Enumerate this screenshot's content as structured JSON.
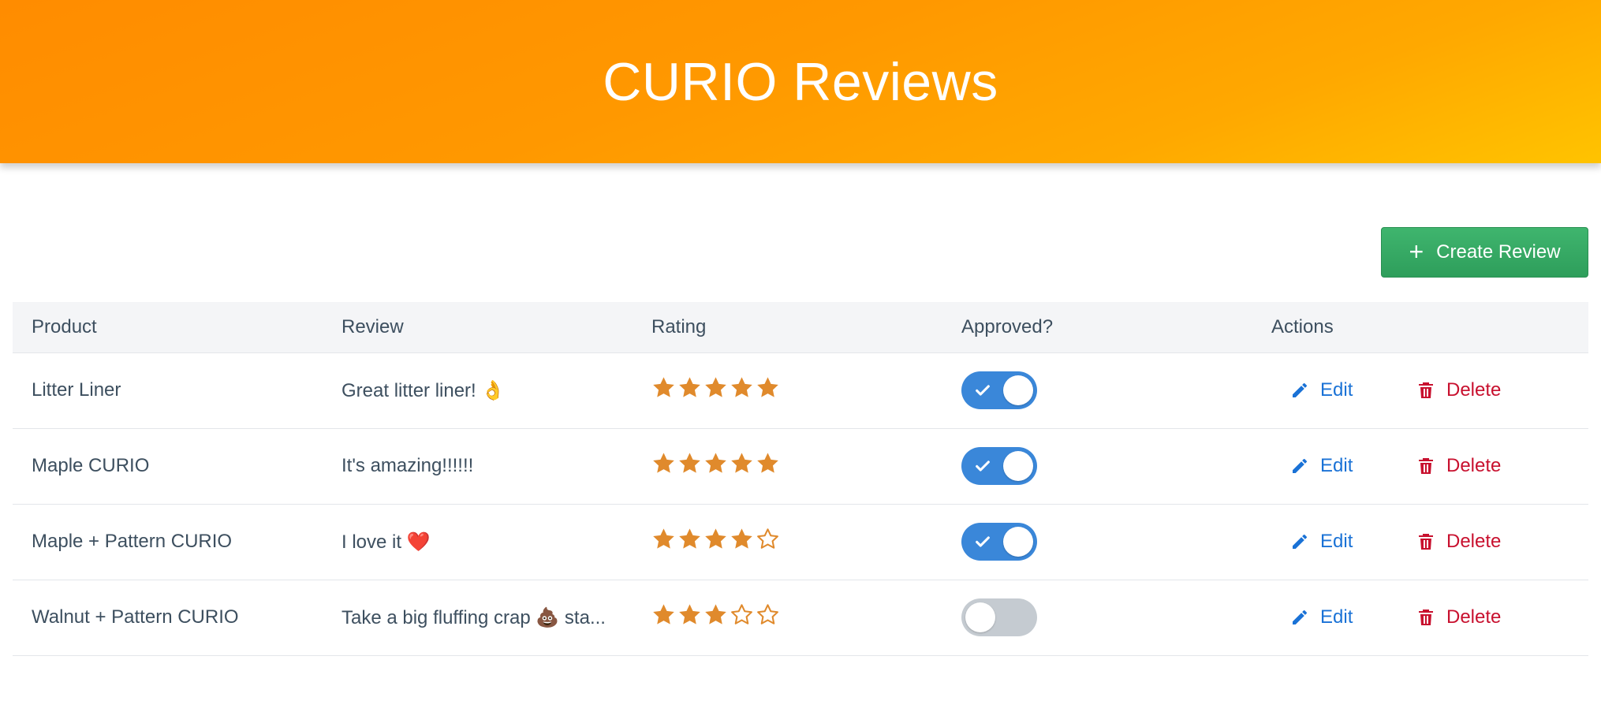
{
  "header": {
    "title": "CURIO Reviews"
  },
  "toolbar": {
    "create_label": "Create Review"
  },
  "table": {
    "columns": [
      "Product",
      "Review",
      "Rating",
      "Approved?",
      "Actions"
    ],
    "rows": [
      {
        "product": "Litter Liner",
        "review": "Great litter liner! 👌",
        "rating": 5,
        "approved": true,
        "edit_label": "Edit",
        "delete_label": "Delete"
      },
      {
        "product": "Maple CURIO",
        "review": "It's amazing!!!!!!",
        "rating": 5,
        "approved": true,
        "edit_label": "Edit",
        "delete_label": "Delete"
      },
      {
        "product": "Maple + Pattern CURIO",
        "review": "I love it ❤️",
        "rating": 4,
        "approved": true,
        "edit_label": "Edit",
        "delete_label": "Delete"
      },
      {
        "product": "Walnut + Pattern CURIO",
        "review": "Take a big fluffing crap 💩 sta...",
        "rating": 3,
        "approved": false,
        "edit_label": "Edit",
        "delete_label": "Delete"
      }
    ],
    "max_rating": 5
  },
  "colors": {
    "header_start": "#ff8c00",
    "header_end": "#ffc300",
    "star": "#e08a2c",
    "toggle_on": "#3a87d9",
    "toggle_off": "#c5cbd1",
    "edit": "#1a72d6",
    "delete": "#c8102e",
    "create_button": "#3fb56e"
  },
  "icons": {
    "create": "plus-icon",
    "edit": "pencil-icon",
    "delete": "trash-icon",
    "rating_full": "star-filled-icon",
    "rating_empty": "star-outline-icon",
    "approved": "check-icon"
  }
}
